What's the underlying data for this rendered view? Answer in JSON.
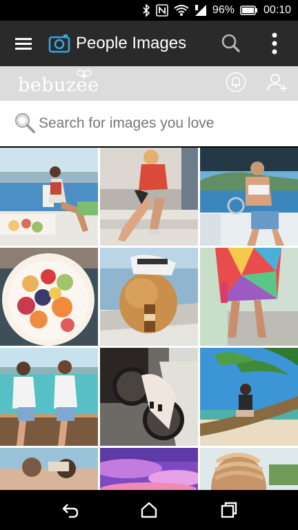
{
  "status_bar": {
    "battery_percent": "96%",
    "time": "00:10",
    "icons": [
      "bluetooth-icon",
      "nfc-icon",
      "wifi-icon",
      "signal-icon",
      "battery-icon"
    ]
  },
  "app_bar": {
    "title": "People Images",
    "icons": [
      "hamburger-menu-icon",
      "camera-app-icon",
      "search-icon",
      "more-vert-icon"
    ]
  },
  "brand_bar": {
    "logo_text": "bebuzee",
    "icons": [
      "bee-icon",
      "bell-icon",
      "add-user-icon"
    ]
  },
  "search": {
    "placeholder": "Search for images you love"
  },
  "grid": {
    "tiles": [
      {
        "subject": "woman on terrace overlooking sea"
      },
      {
        "subject": "woman sitting on stairs"
      },
      {
        "subject": "woman on boat deck"
      },
      {
        "subject": "fruit bowl"
      },
      {
        "subject": "puppy with cap and bottle"
      },
      {
        "subject": "colorful dress with drink"
      },
      {
        "subject": "two women by the sea"
      },
      {
        "subject": "sunglasses and handbag"
      },
      {
        "subject": "woman in palm tree"
      },
      {
        "subject": "couple at beach"
      },
      {
        "subject": "purple sunset sky"
      },
      {
        "subject": "braided hair"
      }
    ]
  },
  "nav_bar": {
    "icons": [
      "back-icon",
      "home-icon",
      "recents-icon"
    ]
  },
  "colors": {
    "app_bar": "#2a2a2a",
    "brand_bar": "#dcdcdc",
    "accent_camera": "#3aa6dd"
  }
}
